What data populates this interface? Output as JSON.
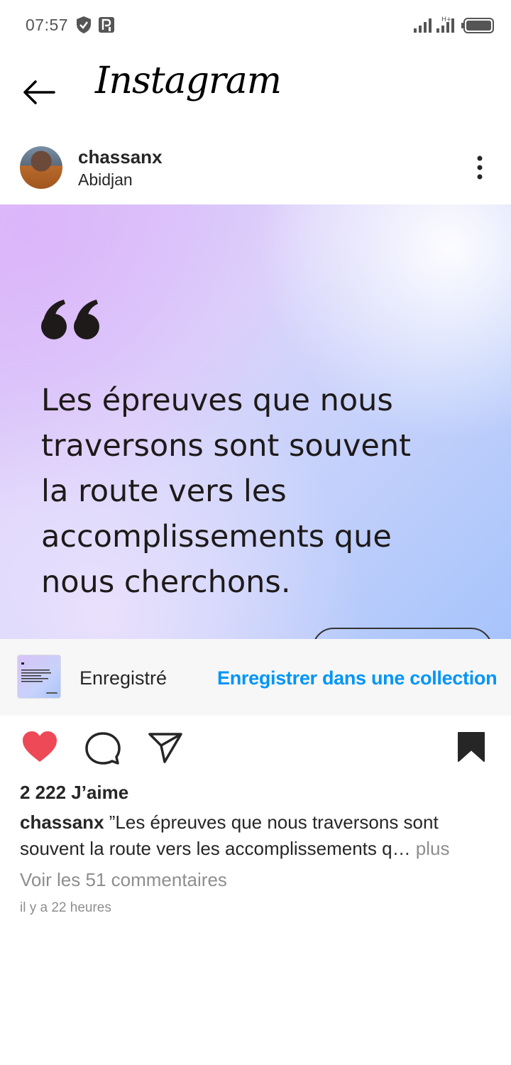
{
  "status_bar": {
    "time": "07:57",
    "icons": [
      "shield-icon",
      "parking-icon",
      "signal-icon",
      "signal-icon",
      "battery-icon"
    ]
  },
  "header": {
    "back_icon": "arrow-left-icon",
    "title": "Instagram"
  },
  "post": {
    "username": "chassanx",
    "location": "Abidjan",
    "menu_icon": "more-vertical-icon",
    "image": {
      "quote_mark": "❝",
      "lines": [
        "Les épreuves que nous",
        "traversons sont souvent",
        "la route vers les",
        "accomplissements que",
        "nous cherchons."
      ]
    }
  },
  "saved_banner": {
    "label": "Enregistré",
    "link": "Enregistrer dans une collection"
  },
  "actions": {
    "like_icon": "heart-filled-icon",
    "comment_icon": "comment-icon",
    "share_icon": "send-icon",
    "save_icon": "bookmark-filled-icon",
    "like_color": "#ed4956"
  },
  "likes": "2 222 J’aime",
  "caption": {
    "user": "chassanx",
    "text": " ”Les épreuves que nous traversons sont souvent la route vers les accomplissements q…",
    "more": " plus"
  },
  "comments_link": "Voir les 51 commentaires",
  "timestamp": "il y a 22 heures",
  "colors": {
    "accent": "#0095f6",
    "text": "#262626",
    "secondary": "#8e8e8e"
  }
}
